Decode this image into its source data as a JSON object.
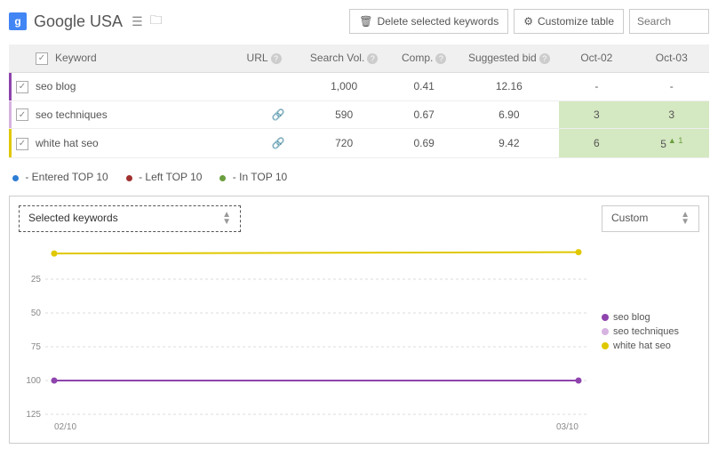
{
  "header": {
    "title": "Google USA",
    "delete_btn": "Delete selected keywords",
    "customize_btn": "Customize table",
    "search_placeholder": "Search"
  },
  "columns": {
    "keyword": "Keyword",
    "url": "URL",
    "search_vol": "Search Vol.",
    "comp": "Comp.",
    "suggested_bid": "Suggested bid",
    "date1": "Oct-02",
    "date2": "Oct-03"
  },
  "rows": [
    {
      "mark": "#8e44ad",
      "keyword": "seo blog",
      "link": false,
      "vol": "1,000",
      "comp": "0.41",
      "bid": "12.16",
      "d1": "-",
      "d2": "-",
      "green": false,
      "up": ""
    },
    {
      "mark": "#d6b3e0",
      "keyword": "seo techniques",
      "link": true,
      "vol": "590",
      "comp": "0.67",
      "bid": "6.90",
      "d1": "3",
      "d2": "3",
      "green": true,
      "up": ""
    },
    {
      "mark": "#e0c800",
      "keyword": "white hat seo",
      "link": true,
      "vol": "720",
      "comp": "0.69",
      "bid": "9.42",
      "d1": "6",
      "d2": "5",
      "green": true,
      "up": "▲ 1"
    }
  ],
  "legend": {
    "entered": "Entered TOP 10",
    "left": "Left TOP 10",
    "in": "In TOP 10"
  },
  "chart_controls": {
    "selected": "Selected keywords",
    "range": "Custom"
  },
  "chart_data": {
    "type": "line",
    "x": [
      "02/10",
      "03/10"
    ],
    "yticks": [
      25,
      50,
      75,
      100,
      125
    ],
    "ylim": [
      0,
      125
    ],
    "series": [
      {
        "name": "seo blog",
        "color": "#8e44ad",
        "values": [
          100,
          100
        ]
      },
      {
        "name": "seo techniques",
        "color": "#d6b3e0",
        "values": [
          null,
          null
        ]
      },
      {
        "name": "white hat seo",
        "color": "#e0c800",
        "values": [
          6,
          5
        ]
      }
    ]
  }
}
